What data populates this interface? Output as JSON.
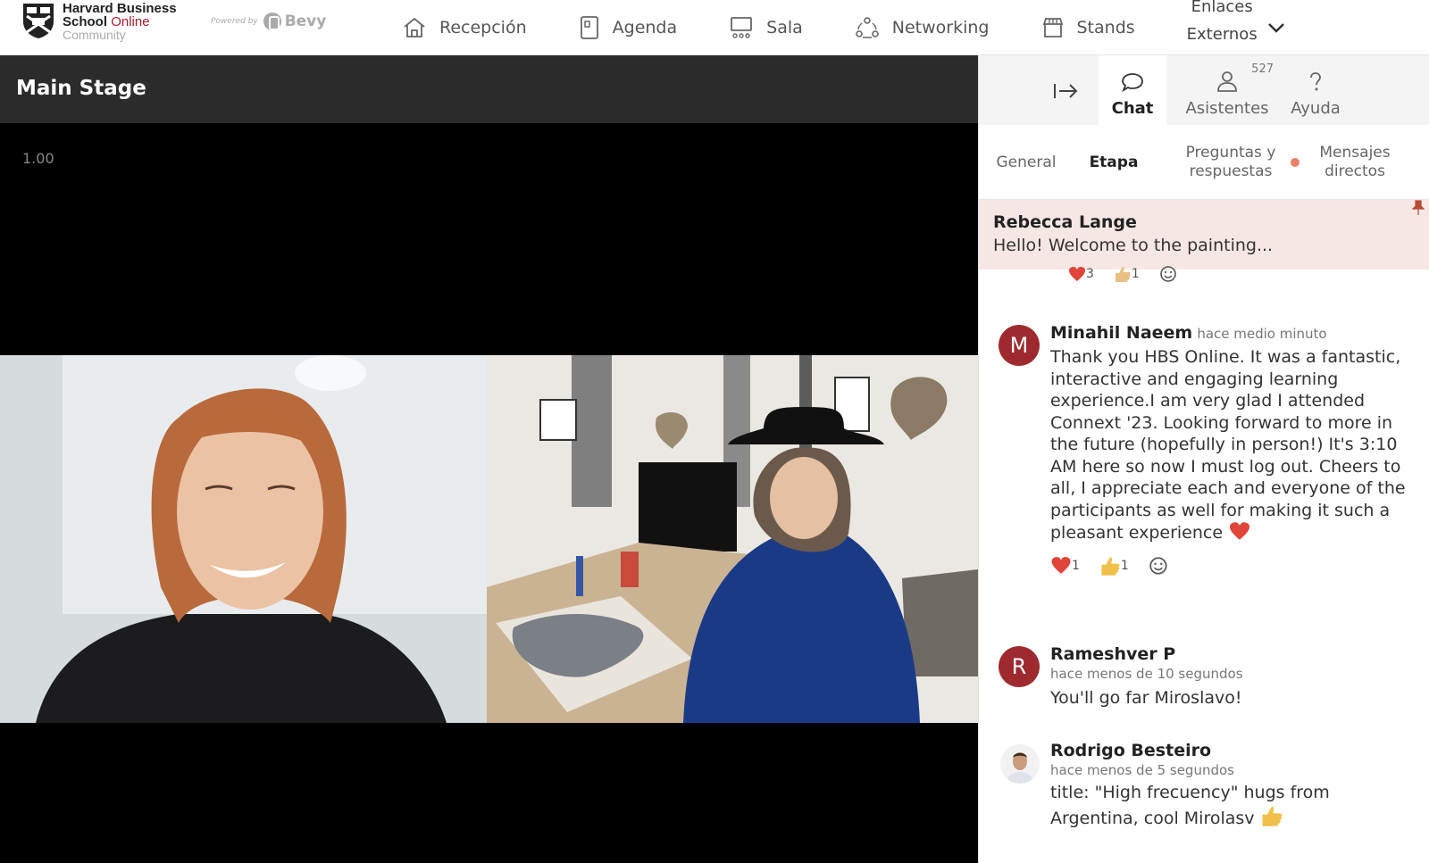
{
  "brand": {
    "line1": "Harvard Business",
    "line2": "School",
    "line2_accent": "Online",
    "line3": "Community",
    "powered_by": "Powered by",
    "platform": "Bevy"
  },
  "nav": {
    "items": [
      {
        "label": "Recepción",
        "icon": "home-icon"
      },
      {
        "label": "Agenda",
        "icon": "agenda-icon"
      },
      {
        "label": "Sala",
        "icon": "screen-icon"
      },
      {
        "label": "Networking",
        "icon": "network-icon"
      },
      {
        "label": "Stands",
        "icon": "store-icon"
      }
    ],
    "external_line1": "Enlaces",
    "external_line2": "Externos"
  },
  "stage": {
    "title": "Main Stage",
    "zoom": "1.00"
  },
  "sidebar": {
    "tabs": [
      {
        "label": "Chat",
        "active": true
      },
      {
        "label": "Asistentes",
        "count": "527"
      },
      {
        "label": "Ayuda"
      }
    ],
    "subtabs": [
      {
        "label": "General"
      },
      {
        "label": "Etapa",
        "active": true
      },
      {
        "label": "Preguntas y respuestas"
      },
      {
        "label": "Mensajes directos"
      }
    ],
    "pinned": {
      "name": "Rebecca Lange",
      "message": "Hello! Welcome to the painting...",
      "reactions": [
        "3",
        "1"
      ]
    },
    "messages": [
      {
        "initial": "M",
        "name": "Minahil Naeem",
        "time": "hace medio minuto",
        "text": "Thank you HBS Online. It was a fantastic, interactive and engaging learning experience.I am very glad I attended Connext '23. Looking forward to more in the future (hopefully in person!) It's 3:10 AM here so now I must log out. Cheers to all, I appreciate each and everyone of the participants as well for making it such a pleasant experience",
        "reactions": [
          "1",
          "1"
        ]
      },
      {
        "initial": "R",
        "name": "Rameshver P",
        "time": "hace menos de 10 segundos",
        "text": "You'll go far Miroslavo!"
      },
      {
        "initial": "",
        "name": "Rodrigo Besteiro",
        "time": "hace menos de 5 segundos",
        "text": "title: \"High frecuency\" hugs from Argentina, cool Mirolasv"
      }
    ]
  },
  "colors": {
    "accent": "#a51c30",
    "stage_header": "#2b2b2b",
    "pinned_bg": "#f7e7e4",
    "dot": "#e8806a"
  }
}
